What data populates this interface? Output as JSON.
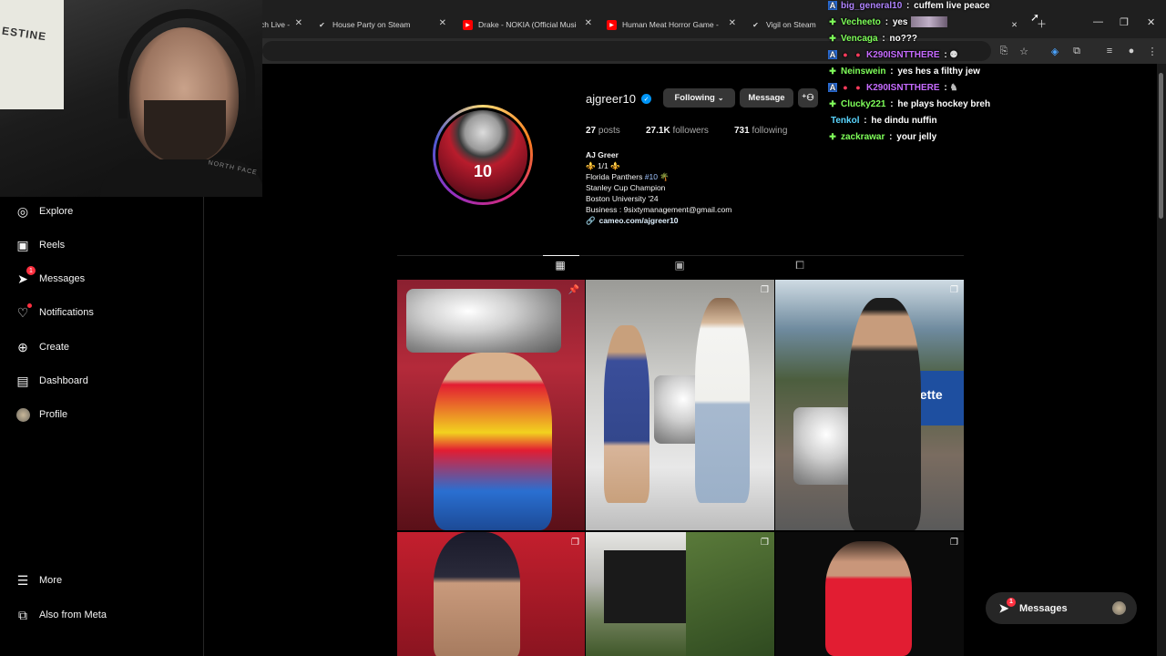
{
  "browser": {
    "tabs": [
      {
        "title": "ch Live - ",
        "icon": "twitch-icon"
      },
      {
        "title": "House Party on Steam",
        "icon": "steam-icon"
      },
      {
        "title": "Drake - NOKIA (Official Music V",
        "icon": "youtube-icon"
      },
      {
        "title": "Human Meat Horror Game - Yo",
        "icon": "youtube-icon"
      },
      {
        "title": "Vigil on Steam",
        "icon": "steam-icon"
      }
    ],
    "new_tab_icon": "plus-icon"
  },
  "webcam": {
    "poster_text": "ESTINE",
    "shirt_text": "NORTH FACE"
  },
  "sidebar": {
    "items": [
      {
        "label": "Explore",
        "icon": "compass-icon"
      },
      {
        "label": "Reels",
        "icon": "reels-icon"
      },
      {
        "label": "Messages",
        "icon": "messenger-icon",
        "badge": "1"
      },
      {
        "label": "Notifications",
        "icon": "heart-icon"
      },
      {
        "label": "Create",
        "icon": "plus-square-icon"
      },
      {
        "label": "Dashboard",
        "icon": "dashboard-icon"
      },
      {
        "label": "Profile",
        "icon": "avatar-icon"
      }
    ],
    "more_label": "More",
    "meta_label": "Also from Meta"
  },
  "profile": {
    "username": "ajgreer10",
    "following_button": "Following",
    "message_button": "Message",
    "posts_count": "27",
    "posts_label": "posts",
    "followers_count": "27.1K",
    "followers_label": "followers",
    "following_count": "731",
    "following_label": "following",
    "avatar_number": "10",
    "bio": {
      "name": "AJ Greer",
      "line1": "⚜️ 1/1 ⚜️",
      "line2_prefix": "Florida Panthers ",
      "line2_tag": "#10",
      "line2_suffix": " 🌴",
      "line3": "Stanley Cup Champion",
      "line4": "Boston University '24",
      "line5": "Business : 9sixtymanagement@gmail.com",
      "link": "cameo.com/ajgreer10"
    }
  },
  "chat": [
    {
      "user": "big_general10",
      "color": "#b084ff",
      "msg": "cuffem live peace",
      "icon": "prime-icon"
    },
    {
      "user": "Vecheeto",
      "color": "#7fff5a",
      "msg": "yes",
      "icon": "sub-icon"
    },
    {
      "user": "Vencaga",
      "color": "#7fff5a",
      "msg": "no???",
      "icon": "sub-icon"
    },
    {
      "user": "K290ISNTTHERE",
      "color": "#c66bff",
      "msg": "",
      "icon": "prime-icon"
    },
    {
      "user": "Neinswein",
      "color": "#7fff5a",
      "msg": "yes hes a filthy jew",
      "icon": "sub-icon"
    },
    {
      "user": "K290ISNTTHERE",
      "color": "#c66bff",
      "msg": "",
      "icon": "prime-icon"
    },
    {
      "user": "Clucky221",
      "color": "#7fff5a",
      "msg": "he plays hockey breh",
      "icon": "sub-icon"
    },
    {
      "user": "Tenkol",
      "color": "#5ad6ff",
      "msg": "he dindu nuffin",
      "icon": ""
    },
    {
      "user": "zackrawar",
      "color": "#7fff5a",
      "msg": "your jelly",
      "icon": "sub-icon"
    }
  ],
  "messages_pill": {
    "label": "Messages",
    "badge": "1"
  }
}
